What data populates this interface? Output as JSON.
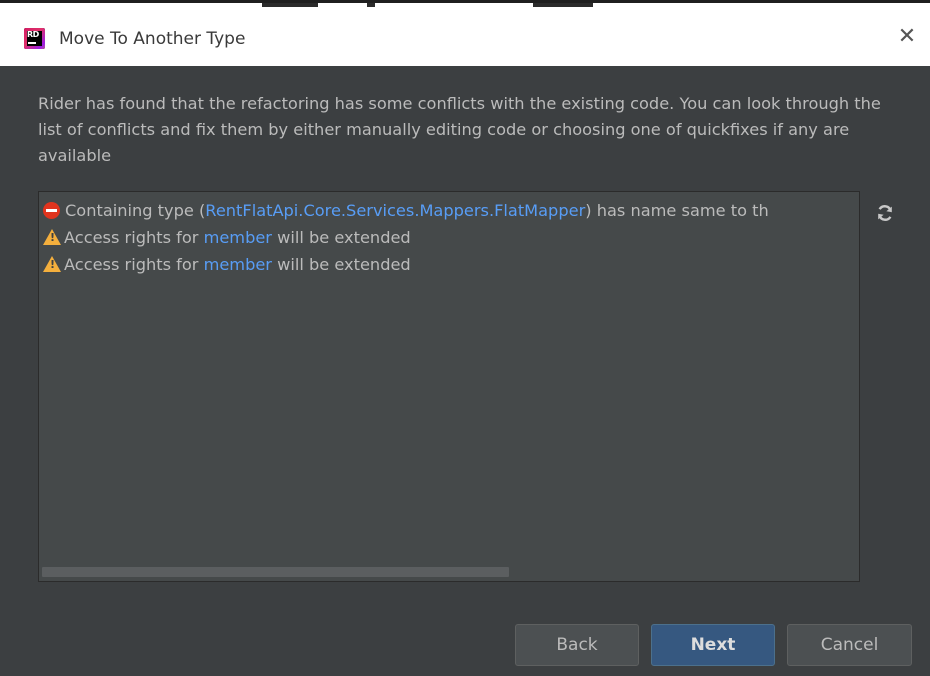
{
  "window": {
    "title": "Move To Another Type",
    "app_icon_text": "RD"
  },
  "message": "Rider has found that the refactoring has some conflicts with the existing code. You can look through the list of conflicts and fix them by either manually editing code or choosing one of quickfixes if any are available",
  "conflicts": [
    {
      "severity": "error",
      "prefix": "Containing type (",
      "link": "RentFlatApi.Core.Services.Mappers.FlatMapper",
      "suffix": ") has name same to th"
    },
    {
      "severity": "warning",
      "prefix": "Access rights for ",
      "link": "member",
      "suffix": " will be extended"
    },
    {
      "severity": "warning",
      "prefix": "Access rights for ",
      "link": "member",
      "suffix": " will be extended"
    }
  ],
  "buttons": {
    "back": "Back",
    "next": "Next",
    "cancel": "Cancel"
  },
  "colors": {
    "background": "#3c3f41",
    "panel": "#45494a",
    "link": "#589df6",
    "error": "#e0341e",
    "warning": "#f4af3d",
    "primary_button": "#365880"
  },
  "icons": {
    "close": "close-icon",
    "refresh": "refresh-icon",
    "error": "error-icon",
    "warning": "warning-icon"
  }
}
